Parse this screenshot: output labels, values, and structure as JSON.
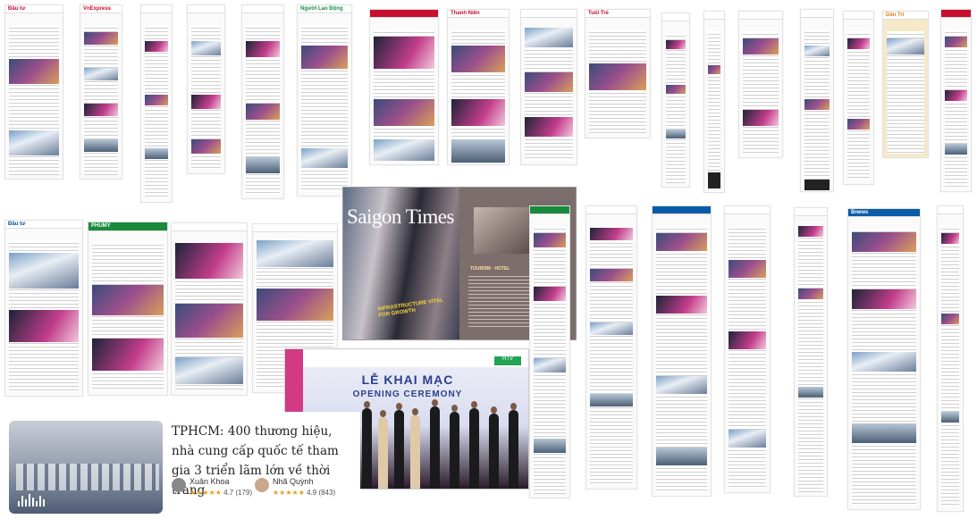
{
  "magazine": {
    "title": "Saigon Times",
    "overlay": "INFRASTRUCTURE VITAL FOR GROWTH",
    "right_caption": "TOURISM · HOTEL"
  },
  "ceremony": {
    "headline_vi": "LỄ KHAI MẠC",
    "headline_en": "OPENING CEREMONY",
    "channel": "HTV"
  },
  "card": {
    "headline": "TPHCM: 400 thương hiệu, nhà cung cấp quốc tế tham gia 3 triển lãm lớn về thời trang",
    "authors": [
      {
        "name": "Xuân Khoa",
        "stars": "★★★★★",
        "rating": "4.7 (179)"
      },
      {
        "name": "Nhã Quỳnh",
        "stars": "★★★★★",
        "rating": "4.9 (843)"
      }
    ]
  },
  "thumbnails": {
    "brands": [
      "Đầu tư",
      "Công Thương",
      "PHUMY",
      "VnExpress",
      "Bnews",
      "Người Lao Động",
      "Thanh Niên",
      "Tuổi Trẻ",
      "Dân Trí",
      "Vietnamnet"
    ]
  }
}
